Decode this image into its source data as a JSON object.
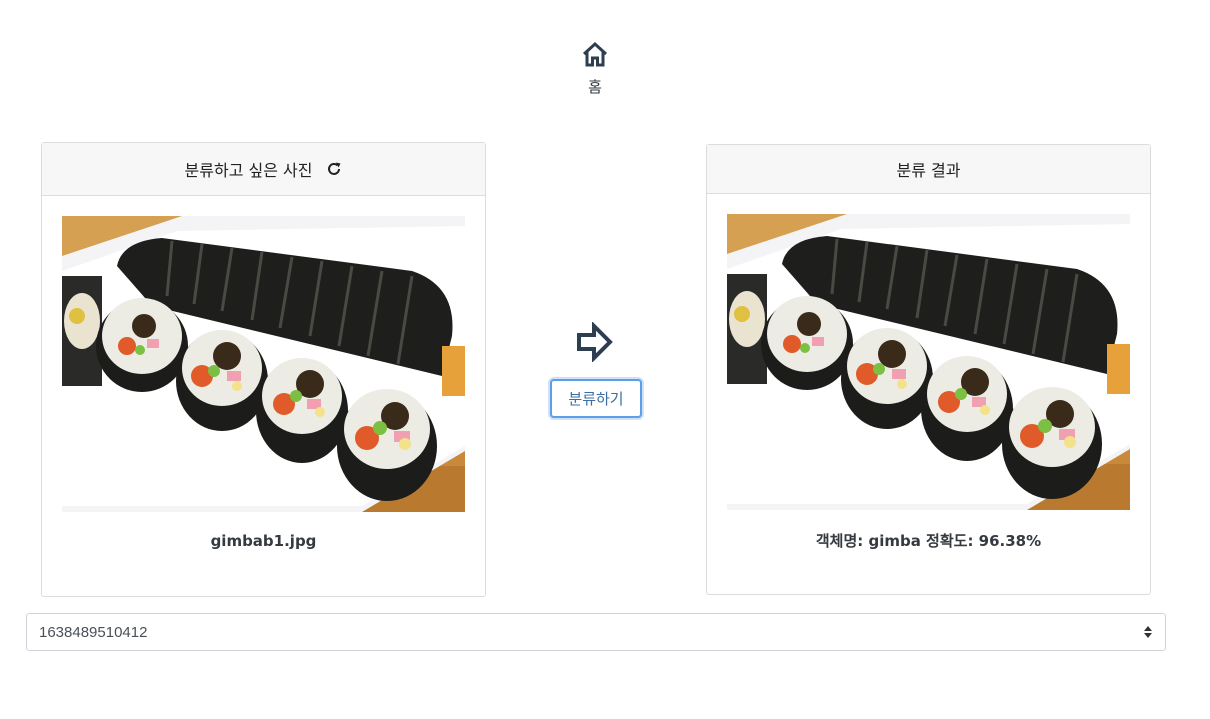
{
  "nav": {
    "home_label": "홈",
    "home_icon": "home-icon"
  },
  "input_card": {
    "title": "분류하고 싶은 사진",
    "refresh_icon": "refresh-icon",
    "image_alt": "gimbap rolls on white plate",
    "filename": "gimbab1.jpg"
  },
  "action": {
    "arrow_icon": "arrow-right-icon",
    "classify_label": "분류하기"
  },
  "result_card": {
    "title": "분류 결과",
    "image_alt": "gimbap rolls on white plate",
    "result_text": "객체명: gimba 정확도: 96.38%"
  },
  "history_select": {
    "selected_value": "1638489510412"
  },
  "colors": {
    "accent_border": "#5b9fe6",
    "button_text": "#3a6ea5",
    "icon": "#2c3e50"
  }
}
